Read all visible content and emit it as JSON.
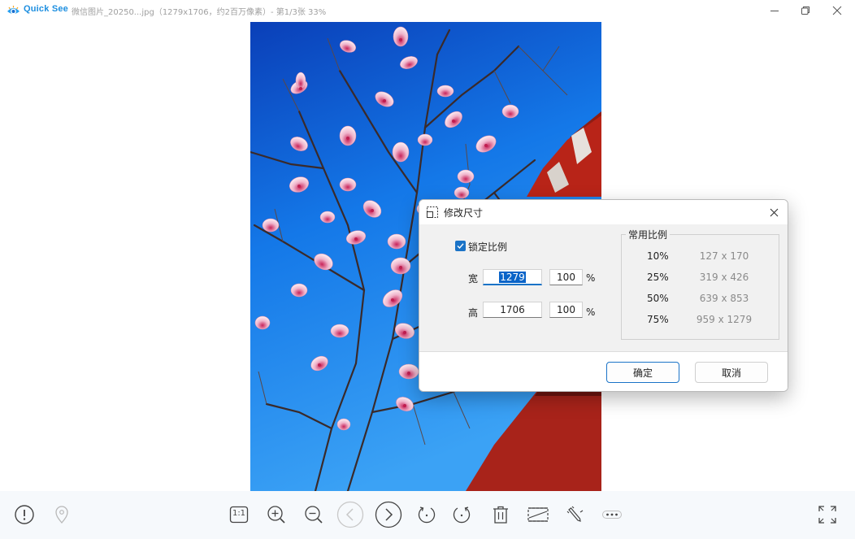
{
  "titlebar": {
    "app_name": "Quick See",
    "file_info": "微信图片_20250...jpg（1279x1706，约2百万像素）- 第1/3张 33%"
  },
  "icons": {
    "logo": "eye-logo-icon",
    "minimize": "minimize-icon",
    "restore": "restore-icon",
    "close": "close-icon"
  },
  "dialog": {
    "title": "修改尺寸",
    "lock_ratio_label": "锁定比例",
    "lock_ratio_checked": true,
    "width_label": "宽",
    "height_label": "高",
    "width_value": "1279",
    "height_value": "1706",
    "width_percent": "100",
    "height_percent": "100",
    "percent_sign": "%",
    "presets_title": "常用比例",
    "presets": [
      {
        "percent": "10%",
        "size": "127 x 170"
      },
      {
        "percent": "25%",
        "size": "319 x 426"
      },
      {
        "percent": "50%",
        "size": "639 x 853"
      },
      {
        "percent": "75%",
        "size": "959 x 1279"
      }
    ],
    "ok_label": "确定",
    "cancel_label": "取消"
  },
  "toolbar": {
    "items": [
      "info-icon",
      "location-icon",
      "actual-size-icon",
      "zoom-in-icon",
      "zoom-out-icon",
      "previous-icon",
      "next-icon",
      "rotate-left-icon",
      "rotate-right-icon",
      "delete-icon",
      "crop-icon",
      "edit-icon",
      "more-icon",
      "fullscreen-icon"
    ],
    "actual_size_label": "1:1"
  },
  "colors": {
    "accent": "#1a73c7",
    "brand": "#1e8fe0",
    "sky": "#1478e8",
    "wall": "#b82418"
  }
}
